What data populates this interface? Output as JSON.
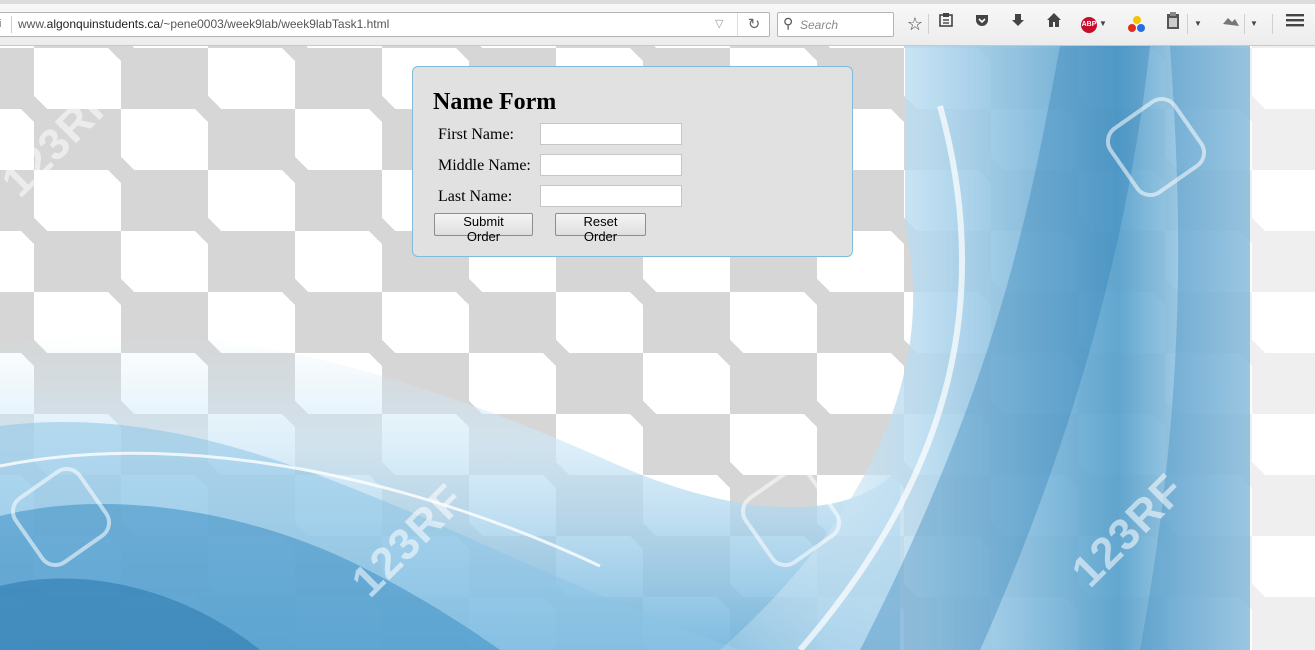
{
  "browser": {
    "url_prefix": "www.",
    "url_domain": "algonquinstudents.ca",
    "url_path": "/~pene0003/week9lab/week9labTask1.html",
    "search_placeholder": "Search",
    "icons": [
      "info-icon",
      "dropdown-arrow-icon",
      "reload-icon",
      "search-icon",
      "bookmark-star-icon",
      "reading-list-icon",
      "pocket-icon",
      "download-icon",
      "home-icon",
      "adblock-plus-icon",
      "colorful-dots-icon",
      "clipboard-icon",
      "extension-icon",
      "hamburger-menu-icon"
    ],
    "abp_label": "ABP"
  },
  "form": {
    "title": "Name Form",
    "fields": [
      {
        "label": "First Name:",
        "value": ""
      },
      {
        "label": "Middle Name:",
        "value": ""
      },
      {
        "label": "Last Name:",
        "value": ""
      }
    ],
    "submit_label": "Submit Order",
    "reset_label": "Reset Order"
  },
  "background": {
    "watermark_text": "123RF",
    "colors": {
      "checker": "#d6d6d6",
      "swirl_blue": "#4a9fd0",
      "form_border": "#7fbbdc",
      "form_bg": "#e1e1e1"
    }
  }
}
